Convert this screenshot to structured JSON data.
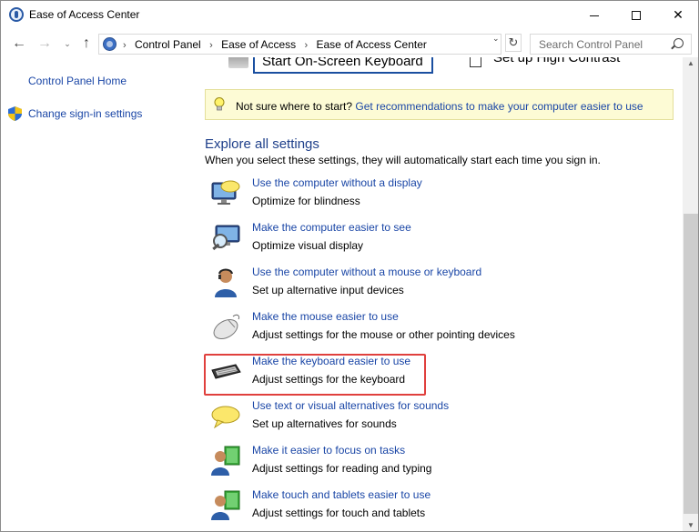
{
  "window": {
    "title": "Ease of Access Center",
    "controls": {
      "minimize": "minimize-icon",
      "maximize": "maximize-icon",
      "close": "✕"
    }
  },
  "nav": {
    "back": "←",
    "forward": "→",
    "recent": "⌄",
    "up": "↑",
    "breadcrumbs": [
      "Control Panel",
      "Ease of Access",
      "Ease of Access Center"
    ],
    "separator": "›",
    "dropdown": "⌄",
    "refresh": "↻",
    "search_placeholder": "Search Control Panel"
  },
  "sidebar": {
    "home": "Control Panel Home",
    "signin": "Change sign-in settings"
  },
  "quick": {
    "osk_label": "Start On-Screen Keyboard",
    "high_contrast_label": "Set up High Contrast"
  },
  "tip": {
    "prefix": "Not sure where to start?",
    "link": "Get recommendations to make your computer easier to use"
  },
  "explore": {
    "title": "Explore all settings",
    "desc": "When you select these settings, they will automatically start each time you sign in."
  },
  "items": [
    {
      "title": "Use the computer without a display",
      "sub": "Optimize for blindness",
      "icon": "monitor-speech-icon"
    },
    {
      "title": "Make the computer easier to see",
      "sub": "Optimize visual display",
      "icon": "monitor-magnifier-icon"
    },
    {
      "title": "Use the computer without a mouse or keyboard",
      "sub": "Set up alternative input devices",
      "icon": "person-headset-icon"
    },
    {
      "title": "Make the mouse easier to use",
      "sub": "Adjust settings for the mouse or other pointing devices",
      "icon": "mouse-icon"
    },
    {
      "title": "Make the keyboard easier to use",
      "sub": "Adjust settings for the keyboard",
      "icon": "keyboard-icon"
    },
    {
      "title": "Use text or visual alternatives for sounds",
      "sub": "Set up alternatives for sounds",
      "icon": "speech-bubble-icon"
    },
    {
      "title": "Make it easier to focus on tasks",
      "sub": "Adjust settings for reading and typing",
      "icon": "person-document-icon"
    },
    {
      "title": "Make touch and tablets easier to use",
      "sub": "Adjust settings for touch and tablets",
      "icon": "person-tablet-icon"
    }
  ],
  "colors": {
    "link": "#1a46a6",
    "highlight": "#e0403d",
    "tip_bg": "#fdfbd5"
  }
}
